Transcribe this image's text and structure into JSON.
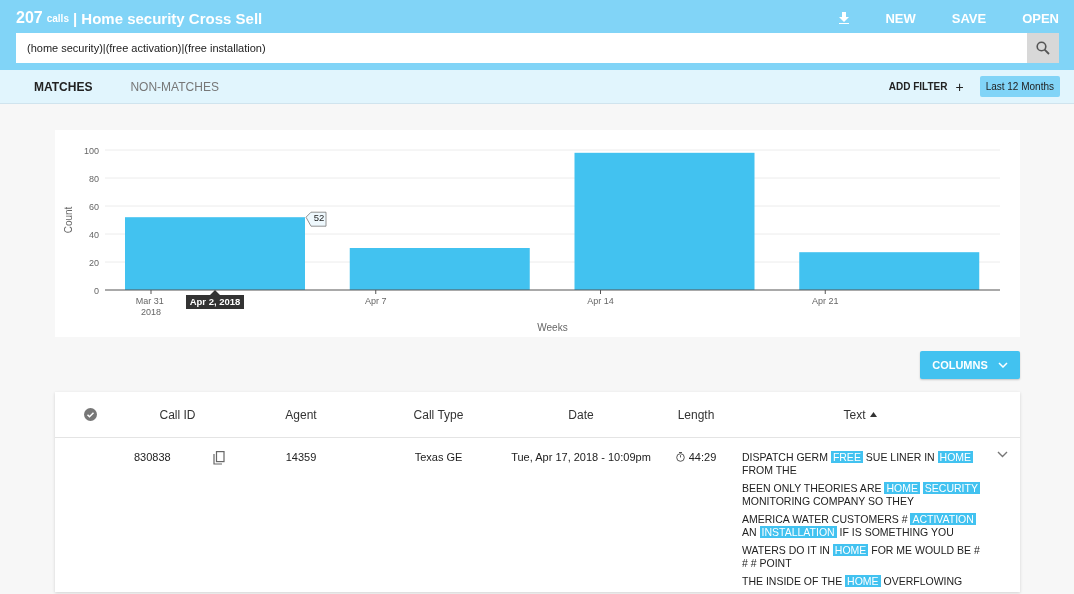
{
  "header": {
    "count": "207",
    "count_unit": "calls",
    "title": "| Home security Cross Sell",
    "actions": [
      {
        "kind": "download"
      },
      {
        "kind": "text",
        "label": "NEW"
      },
      {
        "kind": "text",
        "label": "SAVE"
      },
      {
        "kind": "text",
        "label": "OPEN"
      }
    ]
  },
  "search": {
    "value": "(home security)|(free activation)|(free installation)"
  },
  "tabs": [
    {
      "label": "MATCHES",
      "selected": true
    },
    {
      "label": "NON-MATCHES",
      "selected": false
    }
  ],
  "filter": {
    "add_label": "ADD FILTER",
    "add_icon": "+",
    "range": "Last 12 Months"
  },
  "chart_data": {
    "type": "bar",
    "xlabel": "Weeks",
    "ylabel": "Count",
    "categories": [
      "Mar 31 2018",
      "Apr 7",
      "Apr 14",
      "Apr 21"
    ],
    "values": [
      52,
      30,
      98,
      27
    ],
    "ylim": [
      0,
      100
    ],
    "yticks": [
      0,
      20,
      40,
      60,
      80,
      100
    ],
    "grid": true,
    "annotations": [
      "52",
      "Apr 2, 2018"
    ]
  },
  "columns_button": {
    "label": "COLUMNS"
  },
  "table": {
    "columns": [
      {
        "kind": "check"
      },
      {
        "kind": "text",
        "label": "Call ID"
      },
      {
        "kind": "text",
        "label": "Agent"
      },
      {
        "kind": "text",
        "label": "Call Type"
      },
      {
        "kind": "text",
        "label": "Date"
      },
      {
        "kind": "text",
        "label": "Length"
      },
      {
        "kind": "sorted",
        "label": "Text"
      },
      {
        "kind": "blank"
      }
    ],
    "rows": [
      {
        "call_id": "830838",
        "agent": "14359",
        "call_type": "Texas GE",
        "date": "Tue, Apr 17, 2018 - 10:09pm",
        "length": "44:29",
        "expanded": false,
        "snippets": [
          [
            {
              "text": "DISPATCH GERM",
              "hit": false
            },
            {
              "text": "FREE",
              "hit": true
            },
            {
              "text": "SUE LINER IN",
              "hit": false
            },
            {
              "text": "HOME",
              "hit": true
            },
            {
              "text": "FROM THE",
              "hit": false
            }
          ],
          [
            {
              "text": "BEEN ONLY THEORIES ARE",
              "hit": false
            },
            {
              "text": "HOME",
              "hit": true
            },
            {
              "text": "SECURITY",
              "hit": true
            },
            {
              "text": "MONITORING COMPANY SO THEY",
              "hit": false
            }
          ],
          [
            {
              "text": "AMERICA WATER CUSTOMERS #",
              "hit": false
            },
            {
              "text": "ACTIVATION",
              "hit": true
            },
            {
              "text": "AN",
              "hit": false
            },
            {
              "text": "INSTALLATION",
              "hit": true
            },
            {
              "text": "IF IS SOMETHING YOU",
              "hit": false
            }
          ],
          [
            {
              "text": "WATERS DO IT IN",
              "hit": false
            },
            {
              "text": "HOME",
              "hit": true
            },
            {
              "text": "FOR ME WOULD BE # # # POINT",
              "hit": false
            }
          ],
          [
            {
              "text": "THE INSIDE OF THE",
              "hit": false
            },
            {
              "text": "HOME",
              "hit": true
            },
            {
              "text": "OVERFLOWING",
              "hit": false
            }
          ]
        ]
      }
    ]
  }
}
